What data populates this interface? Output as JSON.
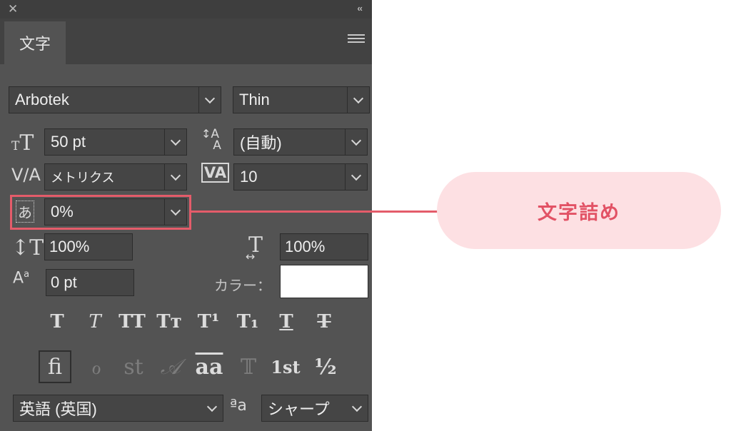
{
  "panel": {
    "title_tab": "文字",
    "icons": {
      "close": "close-icon",
      "collapse": "collapse-icon",
      "menu": "panel-menu-icon"
    }
  },
  "font": {
    "family": "Arbotek",
    "style": "Thin"
  },
  "size": {
    "font_size": "50 pt",
    "leading": "(自動)"
  },
  "kerning": {
    "kerning": "メトリクス",
    "tracking": "10"
  },
  "tsume": {
    "value": "0%"
  },
  "scale": {
    "vertical": "100%",
    "horizontal": "100%"
  },
  "baseline": {
    "shift": "0 pt"
  },
  "color": {
    "label": "カラー：",
    "value": "#ffffff"
  },
  "style_buttons": [
    "T",
    "T",
    "TT",
    "Tт",
    "T¹",
    "T₁",
    "T",
    "T"
  ],
  "opentype_buttons": [
    "fi",
    "ℴ",
    "st",
    "𝒜",
    "aa",
    "𝕋",
    "1st",
    "½"
  ],
  "language": {
    "value": "英語 (英国)",
    "aa_icon": "ªa",
    "antialias": "シャープ"
  },
  "annotation": {
    "label": "文字詰め",
    "color": "#e45c6a",
    "bg": "#fde0e3"
  }
}
